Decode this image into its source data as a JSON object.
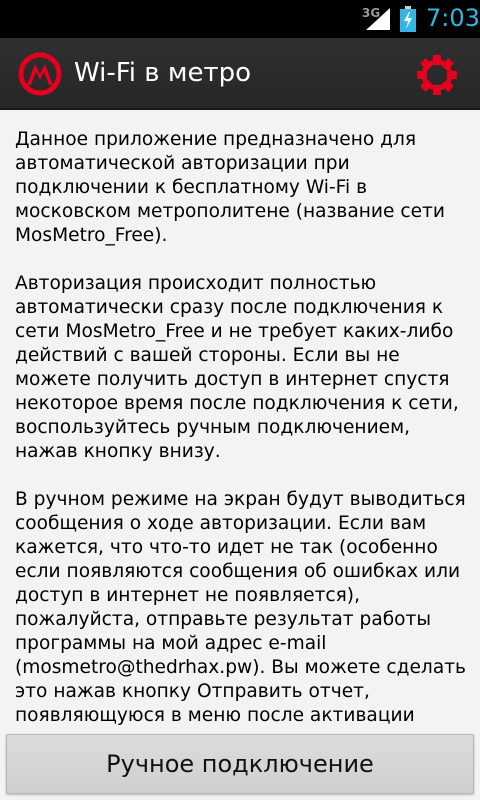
{
  "status_bar": {
    "network": "3G",
    "time": "7:03",
    "icons": [
      "signal-icon",
      "battery-charging-icon"
    ]
  },
  "action_bar": {
    "title": "Wi-Fi в метро",
    "logo_icon": "metro-logo-icon",
    "settings_icon": "gear-icon",
    "accent_color": "#e5001e"
  },
  "content": {
    "paragraphs": [
      "Данное приложение предназначено для автоматической авторизации при подключении к бесплатному Wi-Fi в московском метрополитене (название сети MosMetro_Free).",
      "Авторизация происходит полностью автоматически сразу после подключения к сети MosMetro_Free и не требует каких-либо действий с вашей стороны. Если вы не можете получить доступ в интернет спустя некоторое время после подключения к сети, воспользуйтесь ручным подключением, нажав кнопку внизу.",
      "В ручном режиме на экран будут выводиться сообщения о ходе авторизации. Если вам кажется, что что-то идет не так (особенно если появляются сообщения об ошибках или доступ в интернет не появляется), пожалуйста, отправьте результат работы программы на мой адрес e-mail (mosmetro@thedrhax.pw). Вы можете сделать это нажав кнопку Отправить отчет, появляющуюся в меню после активации"
    ]
  },
  "manual_connect_button": {
    "label": "Ручное подключение"
  }
}
